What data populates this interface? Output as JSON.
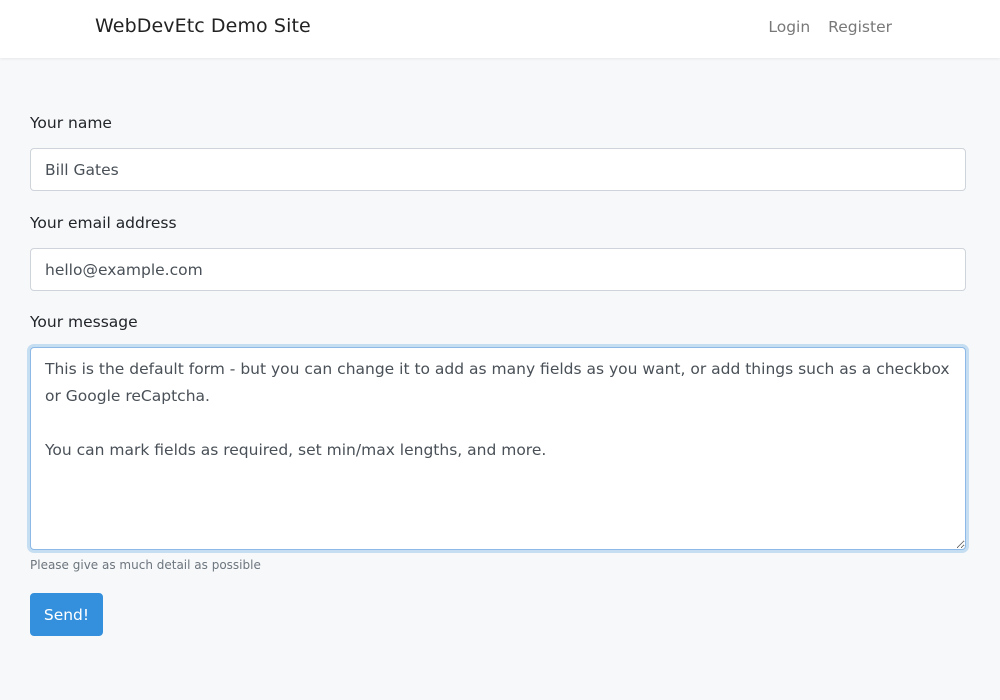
{
  "header": {
    "brand": "WebDevEtc Demo Site",
    "nav": [
      {
        "label": "Login"
      },
      {
        "label": "Register"
      }
    ]
  },
  "form": {
    "name": {
      "label": "Your name",
      "value": "Bill Gates"
    },
    "email": {
      "label": "Your email address",
      "value": "hello@example.com"
    },
    "message": {
      "label": "Your message",
      "value": "This is the default form - but you can change it to add as many fields as you want, or add things such as a checkbox or Google reCaptcha.\n\nYou can mark fields as required, set min/max lengths, and more.",
      "help": "Please give as much detail as possible"
    },
    "submit_label": "Send!"
  },
  "colors": {
    "primary": "#3490dc",
    "background": "#f7f8fa",
    "navbar": "#ffffff"
  }
}
